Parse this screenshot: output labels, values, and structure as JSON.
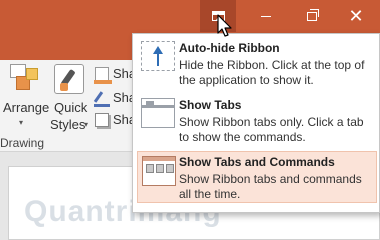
{
  "titlebar": {
    "buttons": {
      "ribbon_display_options": "ribbon-display-options-icon",
      "minimize": "minimize-icon",
      "maximize": "restore-icon",
      "close": "close-icon"
    },
    "close_glyph": "✕",
    "color": "#c85a35"
  },
  "ribbon": {
    "arrange_label": "Arrange",
    "quick_label": "Quick",
    "styles_label": "Styles",
    "shape_fill_label": "Sha",
    "shape_outline_label": "Sha",
    "shape_effects_label": "Sha",
    "group_label": "Drawing",
    "dropdown_arrow": "▾"
  },
  "menu": {
    "items": [
      {
        "title": "Auto-hide Ribbon",
        "description": "Hide the Ribbon. Click at the top of the application to show it.",
        "icon": "auto-hide-ribbon-icon"
      },
      {
        "title": "Show Tabs",
        "description": "Show Ribbon tabs only. Click a tab to show the commands.",
        "icon": "show-tabs-icon"
      },
      {
        "title": "Show Tabs and Commands",
        "description": "Show Ribbon tabs and commands all the time.",
        "icon": "show-tabs-and-commands-icon",
        "selected": true
      }
    ]
  },
  "watermark": "Quantrimang",
  "colors": {
    "accent": "#c85a35",
    "selected_bg": "#fbe3d8",
    "arrow_blue": "#2e6db5"
  }
}
